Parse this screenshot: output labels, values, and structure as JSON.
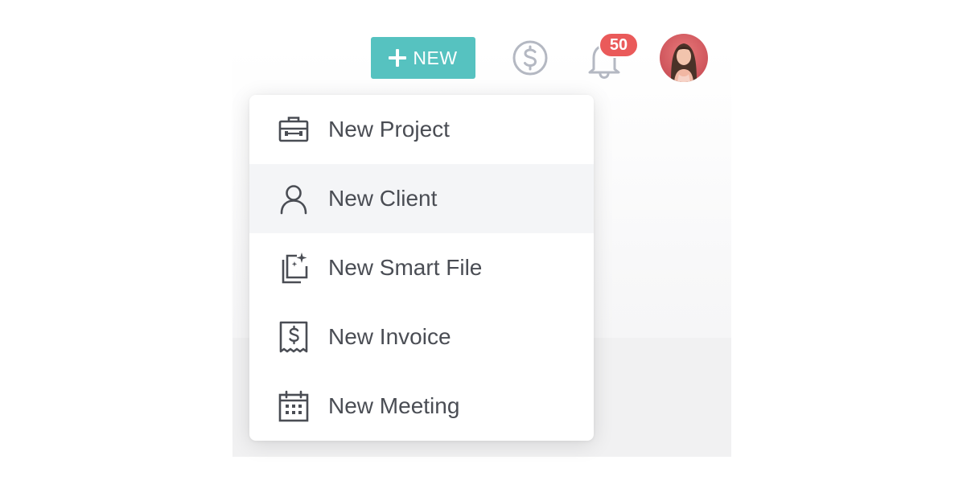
{
  "header": {
    "new_button_label": "NEW",
    "notification_count": "50",
    "icons": {
      "new": "plus-icon",
      "payments": "dollar-circle-icon",
      "notifications": "bell-icon",
      "profile": "avatar"
    }
  },
  "menu": {
    "hovered_index": 1,
    "items": [
      {
        "label": "New Project",
        "icon": "briefcase-icon"
      },
      {
        "label": "New Client",
        "icon": "person-icon"
      },
      {
        "label": "New Smart File",
        "icon": "smart-file-icon"
      },
      {
        "label": "New Invoice",
        "icon": "invoice-icon"
      },
      {
        "label": "New Meeting",
        "icon": "calendar-icon"
      }
    ]
  },
  "colors": {
    "accent": "#56c2c0",
    "badge": "#ea5a5a",
    "icon_gray": "#b4b8c2",
    "menu_text": "#4a4d54",
    "hover_bg": "#f4f5f7"
  }
}
